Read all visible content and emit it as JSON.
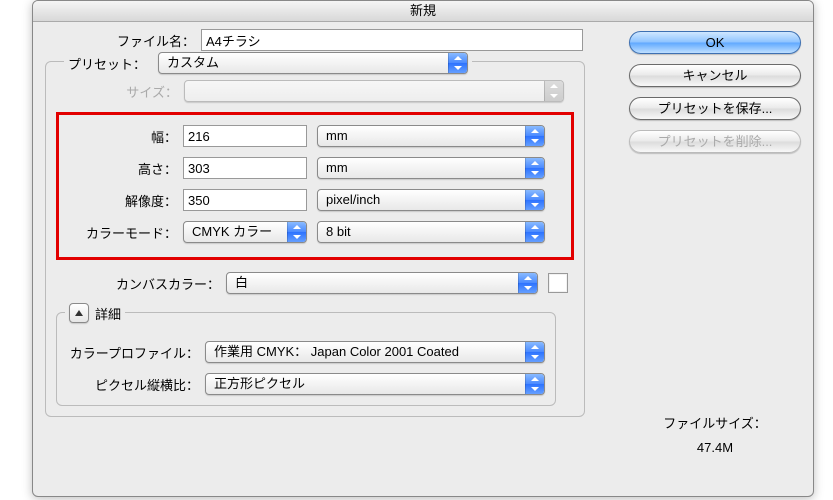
{
  "title": "新規",
  "filename": {
    "label": "ファイル名：",
    "value": "A4チラシ"
  },
  "preset": {
    "label": "プリセット：",
    "value": "カスタム"
  },
  "size": {
    "label": "サイズ：",
    "value": ""
  },
  "width": {
    "label": "幅：",
    "value": "216",
    "unit": "mm"
  },
  "height": {
    "label": "高さ：",
    "value": "303",
    "unit": "mm"
  },
  "resolution": {
    "label": "解像度：",
    "value": "350",
    "unit": "pixel/inch"
  },
  "color_mode": {
    "label": "カラーモード：",
    "mode": "CMYK カラー",
    "depth": "8 bit"
  },
  "canvas_color": {
    "label": "カンバスカラー：",
    "value": "白"
  },
  "advanced": {
    "label": "詳細"
  },
  "color_profile": {
    "label": "カラープロファイル：",
    "value": "作業用 CMYK： Japan Color 2001 Coated"
  },
  "pixel_aspect": {
    "label": "ピクセル縦横比：",
    "value": "正方形ピクセル"
  },
  "buttons": {
    "ok": "OK",
    "cancel": "キャンセル",
    "save_preset": "プリセットを保存...",
    "delete_preset": "プリセットを削除..."
  },
  "file_size": {
    "label": "ファイルサイズ：",
    "value": "47.4M"
  }
}
